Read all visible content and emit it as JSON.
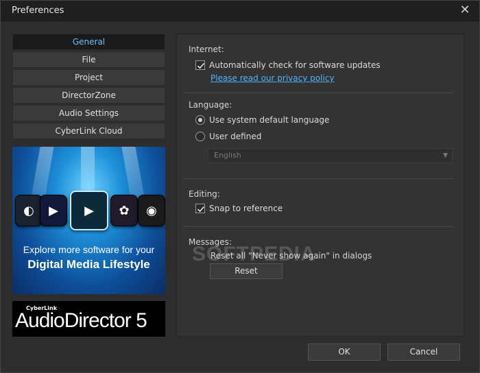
{
  "window": {
    "title": "Preferences"
  },
  "nav": {
    "items": [
      {
        "label": "General",
        "active": true
      },
      {
        "label": "File",
        "active": false
      },
      {
        "label": "Project",
        "active": false
      },
      {
        "label": "DirectorZone",
        "active": false
      },
      {
        "label": "Audio Settings",
        "active": false
      },
      {
        "label": "CyberLink Cloud",
        "active": false
      }
    ]
  },
  "promo": {
    "line1": "Explore more software for your",
    "line2": "Digital Media Lifestyle"
  },
  "product": {
    "brand": "CyberLink",
    "name": "AudioDirector 5"
  },
  "internet": {
    "title": "Internet:",
    "auto_update_label": "Automatically check for software updates",
    "auto_update_checked": true,
    "privacy_link": "Please read our privacy policy"
  },
  "language": {
    "title": "Language:",
    "system_default_label": "Use system default language",
    "user_defined_label": "User defined",
    "selected": "system_default",
    "dropdown_value": "English"
  },
  "editing": {
    "title": "Editing:",
    "snap_label": "Snap to reference",
    "snap_checked": true
  },
  "messages": {
    "title": "Messages:",
    "reset_desc": "Reset all \"Never show again\" in dialogs",
    "reset_button": "Reset"
  },
  "watermark": "SOFTPEDIA",
  "footer": {
    "ok_label": "OK",
    "cancel_label": "Cancel"
  },
  "colors": {
    "accent": "#6fc0ff",
    "link": "#4fb3ff",
    "background": "#2d2d2d"
  }
}
